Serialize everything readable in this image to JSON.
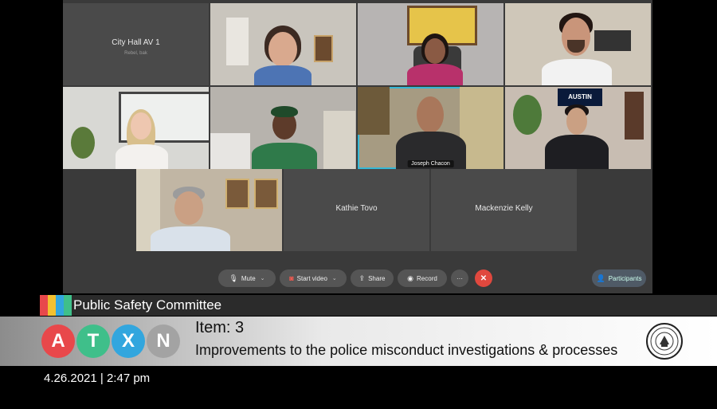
{
  "meeting": {
    "tiles": [
      {
        "name": "City Hall AV 1",
        "subtitle": "Rebel, bak"
      },
      {
        "name": ""
      },
      {
        "name": ""
      },
      {
        "name": ""
      },
      {
        "name": ""
      },
      {
        "name": ""
      },
      {
        "name": "Joseph Chacon"
      },
      {
        "name": ""
      },
      {
        "name": ""
      },
      {
        "name": "Kathie Tovo"
      },
      {
        "name": "Mackenzie Kelly"
      }
    ],
    "poster_text": "AUSTIN"
  },
  "toolbar": {
    "mute_label": "Mute",
    "start_video_label": "Start video",
    "share_label": "Share",
    "record_label": "Record",
    "more_label": "···",
    "end_label": "✕",
    "participants_label": "Participants"
  },
  "broadcast": {
    "committee": "Public Safety Committee",
    "logo_letters": [
      "A",
      "T",
      "X",
      "N"
    ],
    "logo_colors": [
      "#e8484b",
      "#3fbf8a",
      "#32a6de",
      "#a3a3a3"
    ],
    "stripe_colors": [
      "#e8484b",
      "#f3c130",
      "#32a6de",
      "#3fbf8a"
    ],
    "item_label": "Item: 3",
    "item_description": "Improvements to the police misconduct investigations & processes",
    "datetime": "4.26.2021 | 2:47 pm"
  }
}
